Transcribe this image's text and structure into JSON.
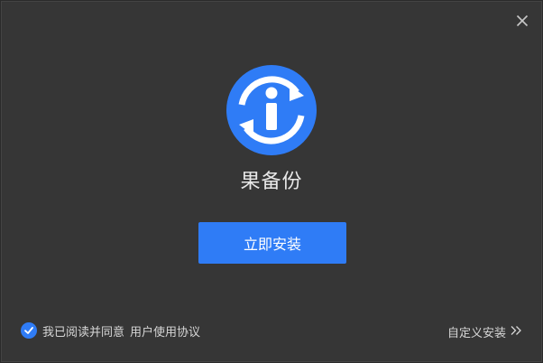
{
  "app": {
    "name": "果备份"
  },
  "install": {
    "button_label": "立即安装"
  },
  "agreement": {
    "text": "我已阅读并同意",
    "link": "用户使用协议",
    "checked": true
  },
  "custom_install": {
    "label": "自定义安装"
  },
  "colors": {
    "accent": "#2f7cf6",
    "background": "#363636",
    "text": "#d6d6d6"
  },
  "icons": {
    "close": "close-icon",
    "logo": "info-sync-logo-icon",
    "check": "check-icon",
    "chevron": "double-chevron-right-icon"
  }
}
